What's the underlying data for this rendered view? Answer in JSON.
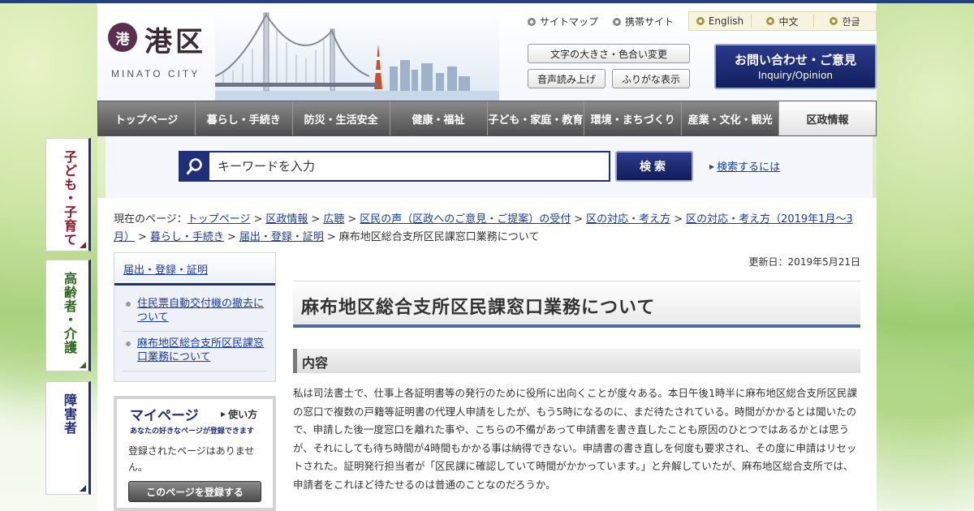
{
  "header": {
    "logo_mark": "港",
    "logo_name": "港区",
    "logo_sub": "MINATO CITY",
    "util_links": [
      "サイトマップ",
      "携帯サイト"
    ],
    "languages": [
      "English",
      "中文",
      "한글"
    ],
    "tools": {
      "font_color": "文字の大きさ・色合い変更",
      "read_aloud": "音声読み上げ",
      "furigana": "ふりがな表示"
    },
    "inquiry": {
      "main": "お問い合わせ・ご意見",
      "sub": "Inquiry/Opinion"
    }
  },
  "gnav": [
    "トップページ",
    "暮らし・手続き",
    "防災・生活安全",
    "健康・福祉",
    "子ども・家庭・教育",
    "環境・まちづくり",
    "産業・文化・観光",
    "区政情報"
  ],
  "search": {
    "placeholder": "キーワードを入力",
    "button": "検索",
    "help": "検索するには"
  },
  "side_tabs": [
    "子ども・子育て",
    "高齢者・介護",
    "障害者"
  ],
  "breadcrumb": {
    "prefix": "現在のページ：",
    "links": [
      "トップページ",
      "区政情報",
      "広聴",
      "区民の声（区政へのご意見・ご提案）の受付",
      "区の対応・考え方",
      "区の対応・考え方（2019年1月～3月）",
      "暮らし・手続き",
      "届出・登録・証明"
    ],
    "current": "麻布地区総合支所区民課窓口業務について"
  },
  "local_nav": {
    "title": "届出・登録・証明",
    "items": [
      "住民票自動交付機の撤去について",
      "麻布地区総合支所区民課窓口業務について"
    ]
  },
  "mypage": {
    "title": "マイページ",
    "howto": "使い方",
    "sub": "あなたの好きなページが登録できます",
    "empty": "登録されたページはありません。",
    "register": "このページを登録する"
  },
  "content": {
    "updated": "更新日：2019年5月21日",
    "title": "麻布地区総合支所区民課窓口業務について",
    "section": "内容",
    "body": "私は司法書士で、仕事上各証明書等の発行のために役所に出向くことが度々ある。本日午後1時半に麻布地区総合支所区民課の窓口で複数の戸籍等証明書の代理人申請をしたが、もう5時になるのに、まだ待たされている。時間がかかるとは聞いたので、申請した後一度窓口を離れた事や、こちらの不備があって申請書を書き直したことも原因のひとつではあるかとは思うが、それにしても待ち時間が4時間もかかる事は納得できない。申請書の書き直しを何度も要求され、その度に申請はリセットされた。証明発行担当者が「区民課に確認していて時間がかかっています。」と弁解していたが、麻布地区総合支所では、申請者をこれほど待たせるのは普通のことなのだろうか。"
  },
  "colors": {
    "navy": "#1f2f7a",
    "link": "#1a3c96",
    "nav_gray": "#5a5a5a",
    "kids_tab": "#8a1c2b",
    "elder_tab": "#2d6a1e",
    "disabled_tab": "#1f2f7a"
  }
}
